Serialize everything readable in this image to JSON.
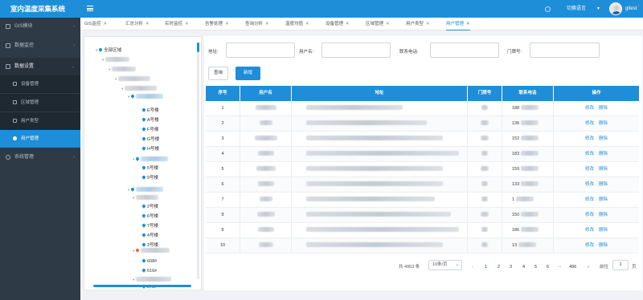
{
  "app": {
    "title": "室内温度采集系统",
    "language": "切换语言",
    "user": "gltest"
  },
  "sidebar": {
    "items": [
      {
        "label": "GIS模块"
      },
      {
        "label": "数据监控"
      },
      {
        "label": "数据设置"
      },
      {
        "label": "设备管理"
      },
      {
        "label": "区域管理"
      },
      {
        "label": "用户类型"
      },
      {
        "label": "用户管理"
      },
      {
        "label": "系统管理"
      }
    ]
  },
  "tabs": [
    {
      "label": "GIS监控"
    },
    {
      "label": "汇总分析"
    },
    {
      "label": "实时监控"
    },
    {
      "label": "告警处理"
    },
    {
      "label": "查询分析"
    },
    {
      "label": "温度均值"
    },
    {
      "label": "设备管理"
    },
    {
      "label": "区域管理"
    },
    {
      "label": "用户类型"
    },
    {
      "label": "用户管理"
    }
  ],
  "tree": {
    "root": "全部区域",
    "buildings_a": [
      "E号楼",
      "A号楼",
      "F号楼",
      "G号楼",
      "H号楼"
    ],
    "buildings_b": [
      "5号楼",
      "9号楼"
    ],
    "buildings_c": [
      "2号楼",
      "6号楼",
      "7号楼",
      "4号楼",
      "3号楼"
    ],
    "buildings_d": [
      "608#",
      "616#",
      "573#"
    ]
  },
  "filters": {
    "address": "地址:",
    "username": "用户名:",
    "phone": "联系电话:",
    "door": "门牌号:"
  },
  "buttons": {
    "query": "查询",
    "add": "新增"
  },
  "table": {
    "headers": [
      "序号",
      "用户名",
      "地址",
      "门牌号",
      "联系电话",
      "操作"
    ],
    "rows": [
      {
        "no": "1",
        "phone": "188"
      },
      {
        "no": "2",
        "phone": "136"
      },
      {
        "no": "3",
        "phone": "152"
      },
      {
        "no": "4",
        "phone": "183"
      },
      {
        "no": "5",
        "phone": "159"
      },
      {
        "no": "6",
        "phone": "133"
      },
      {
        "no": "7",
        "phone": "1"
      },
      {
        "no": "8",
        "phone": "150"
      },
      {
        "no": "9",
        "phone": "186"
      },
      {
        "no": "10",
        "phone": "13"
      }
    ],
    "edit": "修改",
    "delete": "删除"
  },
  "pagination": {
    "total": "共 4953 条",
    "page_size": "10条/页",
    "pages": [
      "1",
      "2",
      "3",
      "4",
      "5",
      "6",
      "···",
      "496"
    ],
    "goto_label": "前往",
    "goto_value": "1",
    "goto_suffix": "页"
  }
}
